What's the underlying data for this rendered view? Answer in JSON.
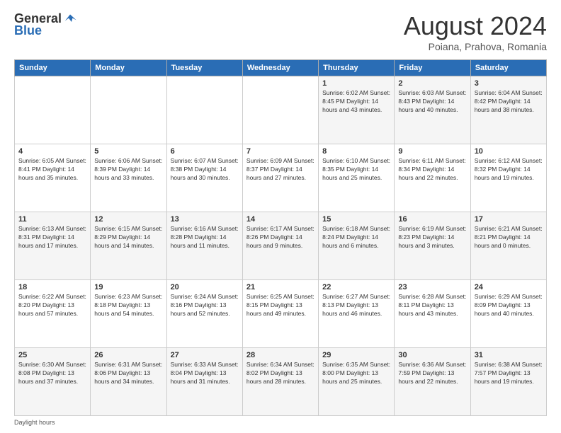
{
  "header": {
    "logo_general": "General",
    "logo_blue": "Blue",
    "month_title": "August 2024",
    "subtitle": "Poiana, Prahova, Romania"
  },
  "weekdays": [
    "Sunday",
    "Monday",
    "Tuesday",
    "Wednesday",
    "Thursday",
    "Friday",
    "Saturday"
  ],
  "footer": {
    "note": "Daylight hours"
  },
  "weeks": [
    [
      {
        "day": "",
        "info": ""
      },
      {
        "day": "",
        "info": ""
      },
      {
        "day": "",
        "info": ""
      },
      {
        "day": "",
        "info": ""
      },
      {
        "day": "1",
        "info": "Sunrise: 6:02 AM\nSunset: 8:45 PM\nDaylight: 14 hours\nand 43 minutes."
      },
      {
        "day": "2",
        "info": "Sunrise: 6:03 AM\nSunset: 8:43 PM\nDaylight: 14 hours\nand 40 minutes."
      },
      {
        "day": "3",
        "info": "Sunrise: 6:04 AM\nSunset: 8:42 PM\nDaylight: 14 hours\nand 38 minutes."
      }
    ],
    [
      {
        "day": "4",
        "info": "Sunrise: 6:05 AM\nSunset: 8:41 PM\nDaylight: 14 hours\nand 35 minutes."
      },
      {
        "day": "5",
        "info": "Sunrise: 6:06 AM\nSunset: 8:39 PM\nDaylight: 14 hours\nand 33 minutes."
      },
      {
        "day": "6",
        "info": "Sunrise: 6:07 AM\nSunset: 8:38 PM\nDaylight: 14 hours\nand 30 minutes."
      },
      {
        "day": "7",
        "info": "Sunrise: 6:09 AM\nSunset: 8:37 PM\nDaylight: 14 hours\nand 27 minutes."
      },
      {
        "day": "8",
        "info": "Sunrise: 6:10 AM\nSunset: 8:35 PM\nDaylight: 14 hours\nand 25 minutes."
      },
      {
        "day": "9",
        "info": "Sunrise: 6:11 AM\nSunset: 8:34 PM\nDaylight: 14 hours\nand 22 minutes."
      },
      {
        "day": "10",
        "info": "Sunrise: 6:12 AM\nSunset: 8:32 PM\nDaylight: 14 hours\nand 19 minutes."
      }
    ],
    [
      {
        "day": "11",
        "info": "Sunrise: 6:13 AM\nSunset: 8:31 PM\nDaylight: 14 hours\nand 17 minutes."
      },
      {
        "day": "12",
        "info": "Sunrise: 6:15 AM\nSunset: 8:29 PM\nDaylight: 14 hours\nand 14 minutes."
      },
      {
        "day": "13",
        "info": "Sunrise: 6:16 AM\nSunset: 8:28 PM\nDaylight: 14 hours\nand 11 minutes."
      },
      {
        "day": "14",
        "info": "Sunrise: 6:17 AM\nSunset: 8:26 PM\nDaylight: 14 hours\nand 9 minutes."
      },
      {
        "day": "15",
        "info": "Sunrise: 6:18 AM\nSunset: 8:24 PM\nDaylight: 14 hours\nand 6 minutes."
      },
      {
        "day": "16",
        "info": "Sunrise: 6:19 AM\nSunset: 8:23 PM\nDaylight: 14 hours\nand 3 minutes."
      },
      {
        "day": "17",
        "info": "Sunrise: 6:21 AM\nSunset: 8:21 PM\nDaylight: 14 hours\nand 0 minutes."
      }
    ],
    [
      {
        "day": "18",
        "info": "Sunrise: 6:22 AM\nSunset: 8:20 PM\nDaylight: 13 hours\nand 57 minutes."
      },
      {
        "day": "19",
        "info": "Sunrise: 6:23 AM\nSunset: 8:18 PM\nDaylight: 13 hours\nand 54 minutes."
      },
      {
        "day": "20",
        "info": "Sunrise: 6:24 AM\nSunset: 8:16 PM\nDaylight: 13 hours\nand 52 minutes."
      },
      {
        "day": "21",
        "info": "Sunrise: 6:25 AM\nSunset: 8:15 PM\nDaylight: 13 hours\nand 49 minutes."
      },
      {
        "day": "22",
        "info": "Sunrise: 6:27 AM\nSunset: 8:13 PM\nDaylight: 13 hours\nand 46 minutes."
      },
      {
        "day": "23",
        "info": "Sunrise: 6:28 AM\nSunset: 8:11 PM\nDaylight: 13 hours\nand 43 minutes."
      },
      {
        "day": "24",
        "info": "Sunrise: 6:29 AM\nSunset: 8:09 PM\nDaylight: 13 hours\nand 40 minutes."
      }
    ],
    [
      {
        "day": "25",
        "info": "Sunrise: 6:30 AM\nSunset: 8:08 PM\nDaylight: 13 hours\nand 37 minutes."
      },
      {
        "day": "26",
        "info": "Sunrise: 6:31 AM\nSunset: 8:06 PM\nDaylight: 13 hours\nand 34 minutes."
      },
      {
        "day": "27",
        "info": "Sunrise: 6:33 AM\nSunset: 8:04 PM\nDaylight: 13 hours\nand 31 minutes."
      },
      {
        "day": "28",
        "info": "Sunrise: 6:34 AM\nSunset: 8:02 PM\nDaylight: 13 hours\nand 28 minutes."
      },
      {
        "day": "29",
        "info": "Sunrise: 6:35 AM\nSunset: 8:00 PM\nDaylight: 13 hours\nand 25 minutes."
      },
      {
        "day": "30",
        "info": "Sunrise: 6:36 AM\nSunset: 7:59 PM\nDaylight: 13 hours\nand 22 minutes."
      },
      {
        "day": "31",
        "info": "Sunrise: 6:38 AM\nSunset: 7:57 PM\nDaylight: 13 hours\nand 19 minutes."
      }
    ]
  ]
}
